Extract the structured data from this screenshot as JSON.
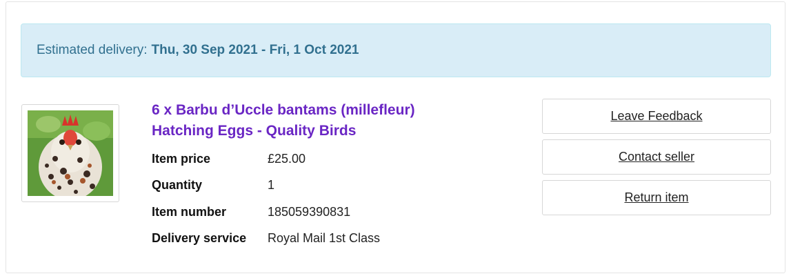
{
  "banner": {
    "label": "Estimated delivery:",
    "dates": "Thu, 30 Sep 2021 - Fri, 1 Oct 2021"
  },
  "item": {
    "title_line1": "6 x Barbu d’Uccle bantams (millefleur)",
    "title_line2": "Hatching Eggs - Quality Birds",
    "image_icon": "chicken-photo",
    "details": [
      {
        "label": "Item price",
        "value": "£25.00"
      },
      {
        "label": "Quantity",
        "value": "1"
      },
      {
        "label": "Item number",
        "value": "185059390831"
      },
      {
        "label": "Delivery service",
        "value": "Royal Mail 1st Class"
      }
    ]
  },
  "actions": {
    "leave_feedback": "Leave Feedback",
    "contact_seller": "Contact seller",
    "return_item": "Return item"
  },
  "colors": {
    "banner_bg": "#d9edf7",
    "banner_text": "#31708f",
    "title": "#6a26c4"
  }
}
